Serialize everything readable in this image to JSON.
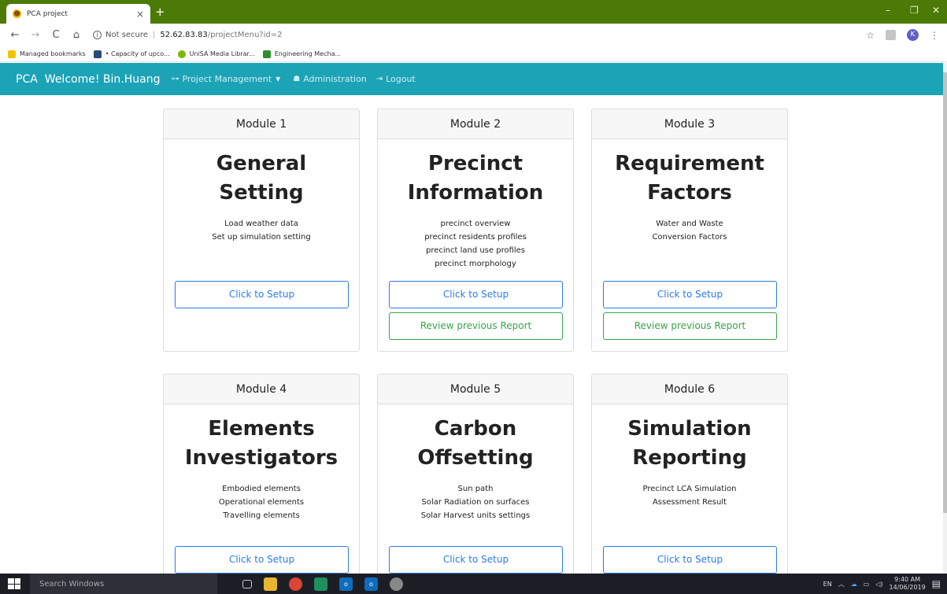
{
  "browser": {
    "tab_title": "PCA project",
    "tab_close": "×",
    "new_tab": "+",
    "window_controls": {
      "minimize": "–",
      "restore": "❐",
      "close": "✕"
    },
    "nav": {
      "back": "←",
      "forward": "→",
      "reload": "C",
      "home": "⌂"
    },
    "security_label": "Not secure",
    "url_host": "52.62.83.83",
    "url_path": "/projectMenu?id=2",
    "profile_initial": "K",
    "bookmarks": [
      {
        "label": "Managed bookmarks",
        "color": "#f2c300"
      },
      {
        "label": "• Capacity of upco...",
        "color": "#2a4a7a"
      },
      {
        "label": "UniSA Media Librar...",
        "color": "#7ab800"
      },
      {
        "label": "Engineering Mecha...",
        "color": "#2f8f2f"
      }
    ]
  },
  "navbar": {
    "brand": "PCA",
    "welcome": "Welcome! Bin.Huang",
    "project_management": "Project Management",
    "administration": "Administration",
    "logout": "Logout",
    "colors": {
      "background": "#1ca3b6"
    }
  },
  "modules": [
    {
      "header": "Module 1",
      "title_line1": "General",
      "title_line2": "Setting",
      "lines": [
        "Load weather data",
        "Set up simulation setting"
      ],
      "setup_label": "Click to Setup",
      "review_label": null
    },
    {
      "header": "Module 2",
      "title_line1": "Precinct",
      "title_line2": "Information",
      "lines": [
        "precinct overview",
        "precinct residents profiles",
        "precinct land use profiles",
        "precinct morphology"
      ],
      "setup_label": "Click to Setup",
      "review_label": "Review previous Report"
    },
    {
      "header": "Module 3",
      "title_line1": "Requirement",
      "title_line2": "Factors",
      "lines": [
        "Water and Waste",
        "Conversion Factors"
      ],
      "setup_label": "Click to Setup",
      "review_label": "Review previous Report"
    },
    {
      "header": "Module 4",
      "title_line1": "Elements",
      "title_line2": "Investigators",
      "lines": [
        "Embodied elements",
        "Operational elements",
        "Travelling elements"
      ],
      "setup_label": "Click to Setup",
      "review_label": null
    },
    {
      "header": "Module 5",
      "title_line1": "Carbon",
      "title_line2": "Offsetting",
      "lines": [
        "Sun path",
        "Solar Radiation on surfaces",
        "Solar Harvest units settings"
      ],
      "setup_label": "Click to Setup",
      "review_label": null
    },
    {
      "header": "Module 6",
      "title_line1": "Simulation",
      "title_line2": "Reporting",
      "lines": [
        "Precinct LCA Simulation",
        "Assessment Result"
      ],
      "setup_label": "Click to Setup",
      "review_label": null
    }
  ],
  "taskbar": {
    "search_placeholder": "Search Windows",
    "language": "EN",
    "time": "9:40 AM",
    "date": "14/06/2019"
  }
}
